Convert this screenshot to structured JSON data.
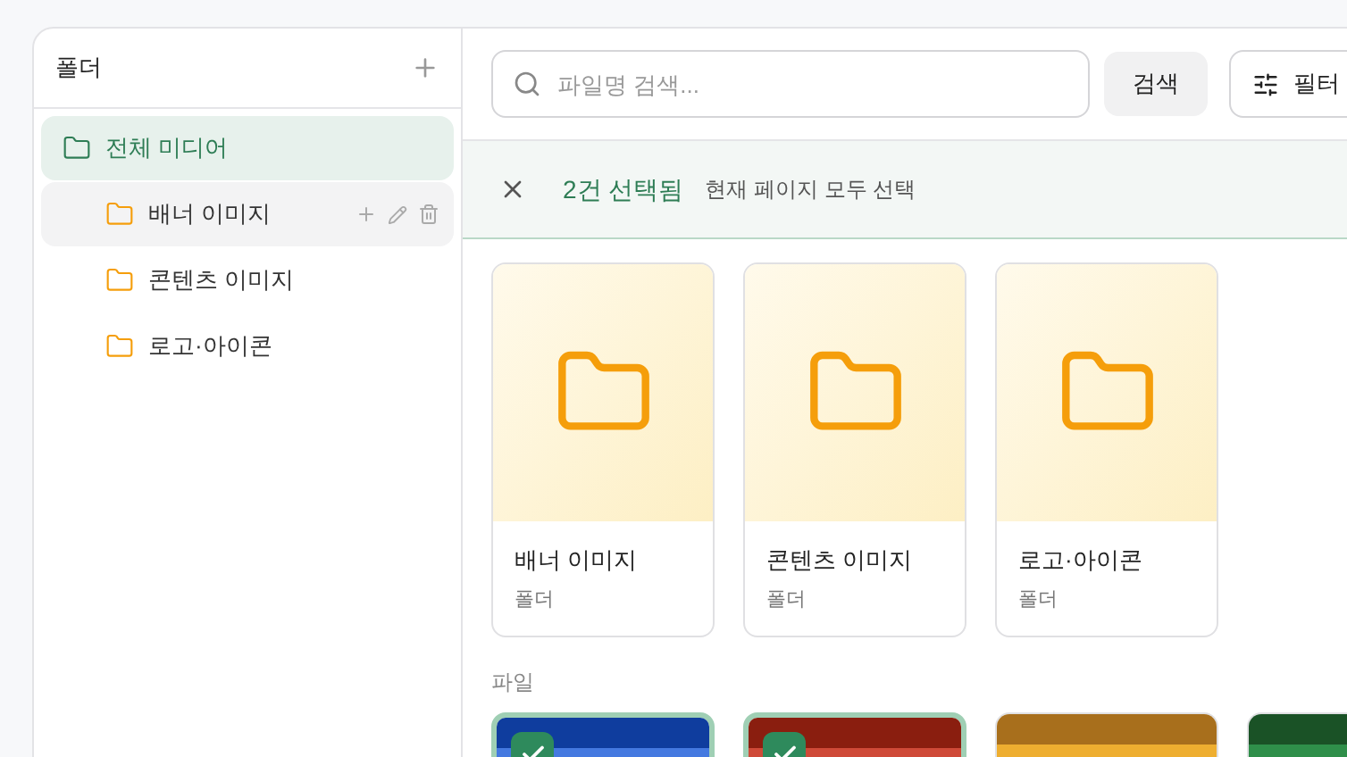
{
  "sidebar": {
    "title": "폴더",
    "items": [
      {
        "label": "전체 미디어",
        "selected": true,
        "hovered": false,
        "children": [
          {
            "label": "배너 이미지",
            "selected": false,
            "hovered": true
          },
          {
            "label": "콘텐츠 이미지",
            "selected": false,
            "hovered": false
          },
          {
            "label": "로고·아이콘",
            "selected": false,
            "hovered": false
          }
        ]
      }
    ]
  },
  "search": {
    "placeholder": "파일명 검색...",
    "button": "검색",
    "filter": "필터"
  },
  "selection_bar": {
    "count": "2건 선택됨",
    "select_all": "현재 페이지 모두 선택"
  },
  "folders": [
    {
      "name": "배너 이미지",
      "type": "폴더"
    },
    {
      "name": "콘텐츠 이미지",
      "type": "폴더"
    },
    {
      "name": "로고·아이콘",
      "type": "폴더"
    }
  ],
  "files_title": "파일",
  "files": [
    {
      "selected": true,
      "color": "#0f3d9e"
    },
    {
      "selected": true,
      "color": "#8a1e0f"
    },
    {
      "selected": false,
      "color": "#a86f1c"
    },
    {
      "selected": false,
      "color": "#1a5226"
    }
  ]
}
